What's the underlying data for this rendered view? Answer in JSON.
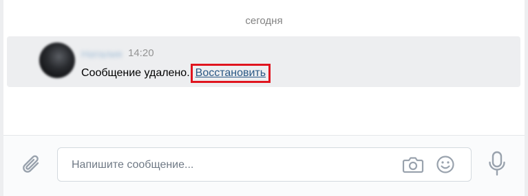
{
  "chat": {
    "date_separator": "сегодня",
    "message": {
      "author": "Наталия",
      "time": "14:20",
      "text": "Сообщение удалено.",
      "restore_link": "Восстановить",
      "highlight_color": "#e0141e",
      "link_color": "#2a5885"
    }
  },
  "composer": {
    "placeholder": "Напишите сообщение...",
    "icons": [
      "paperclip-icon",
      "camera-icon",
      "smile-icon",
      "microphone-icon"
    ]
  }
}
